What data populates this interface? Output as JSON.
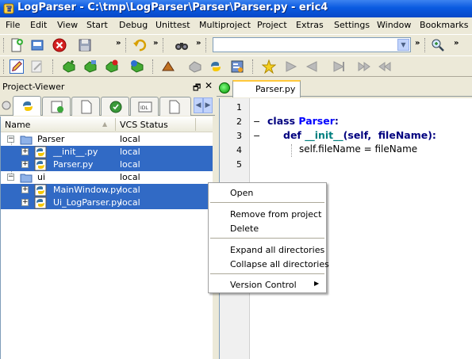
{
  "window": {
    "title": "LogParser - C:\\tmp\\LogParser\\Parser\\Parser.py - eric4"
  },
  "menu": [
    "File",
    "Edit",
    "View",
    "Start",
    "Debug",
    "Unittest",
    "Multiproject",
    "Project",
    "Extras",
    "Settings",
    "Window",
    "Bookmarks"
  ],
  "toolbar": {
    "overflow": "»",
    "search_combo_value": ""
  },
  "project_viewer": {
    "title": "Project-Viewer",
    "float_label": "🗗",
    "close_label": "✕",
    "columns": [
      "Name",
      "VCS Status"
    ],
    "rows": [
      {
        "name": "Parser",
        "vcs": "local",
        "kind": "folder",
        "selected": false
      },
      {
        "name": "__init__.py",
        "vcs": "local",
        "kind": "python",
        "selected": true
      },
      {
        "name": "Parser.py",
        "vcs": "local",
        "kind": "python",
        "selected": true
      },
      {
        "name": "ui",
        "vcs": "local",
        "kind": "folder",
        "selected": false
      },
      {
        "name": "MainWindow.py",
        "vcs": "local",
        "kind": "python",
        "selected": true
      },
      {
        "name": "Ui_LogParser.py",
        "vcs": "local",
        "kind": "python",
        "selected": true
      }
    ]
  },
  "editor": {
    "tab_label": "Parser.py",
    "line_numbers": [
      "1",
      "2",
      "3",
      "4",
      "5"
    ],
    "code": {
      "l2_kw": "class ",
      "l2_name": "Parser",
      "l2_rest": ":",
      "l3_kw": "def ",
      "l3_name": "__init__",
      "l3_rest": "(self,  fileName):",
      "l4": "self.fileName = fileName"
    }
  },
  "context_menu": {
    "items": [
      "Open",
      "Remove from project",
      "Delete",
      "Expand all directories",
      "Collapse all directories",
      "Version Control"
    ],
    "submenu_arrow": "▶"
  }
}
